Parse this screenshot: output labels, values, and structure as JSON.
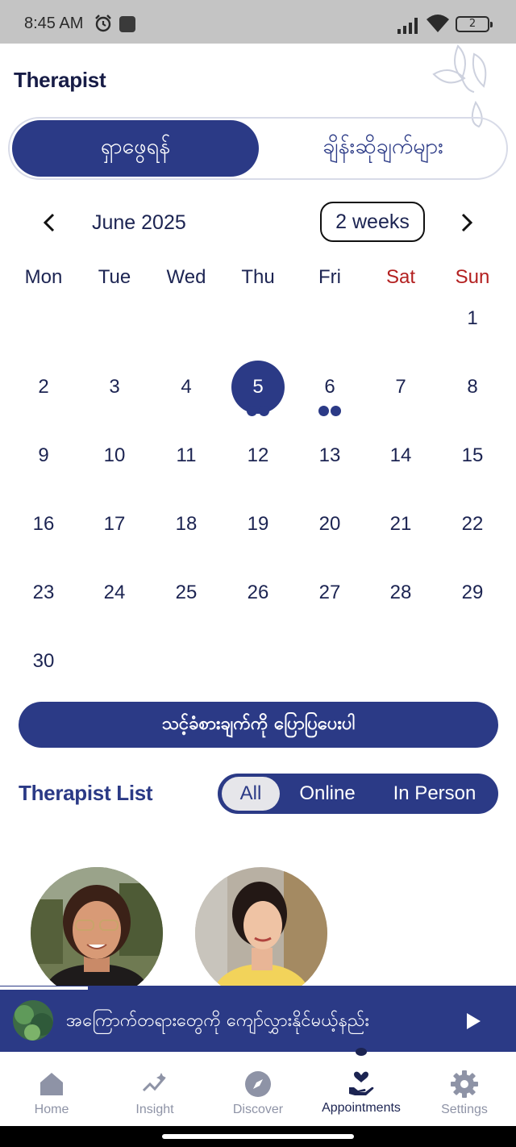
{
  "status_bar": {
    "time": "8:45 AM",
    "battery": "2",
    "icons": [
      "alarm-icon",
      "app-notification-icon",
      "signal-icon",
      "wifi-icon",
      "battery-icon"
    ]
  },
  "header": {
    "title": "Therapist"
  },
  "segment": {
    "active_label": "ရှာဖွေရန်",
    "inactive_label": "ချိန်းဆိုချက်များ"
  },
  "calendar": {
    "month_label": "June 2025",
    "range_label": "2 weeks",
    "weekdays": [
      "Mon",
      "Tue",
      "Wed",
      "Thu",
      "Fri",
      "Sat",
      "Sun"
    ],
    "selected_day": "5",
    "days_with_appointments": [
      "5",
      "6"
    ],
    "weeks": [
      [
        "",
        "",
        "",
        "",
        "",
        "",
        "1"
      ],
      [
        "2",
        "3",
        "4",
        "5",
        "6",
        "7",
        "8"
      ],
      [
        "9",
        "10",
        "11",
        "12",
        "13",
        "14",
        "15"
      ],
      [
        "16",
        "17",
        "18",
        "19",
        "20",
        "21",
        "22"
      ],
      [
        "23",
        "24",
        "25",
        "26",
        "27",
        "28",
        "29"
      ],
      [
        "30",
        "",
        "",
        "",
        "",
        "",
        ""
      ]
    ]
  },
  "cta": {
    "label": "သင့်ခံစားချက်ကို ပြောပြပေးပါ"
  },
  "therapist_list": {
    "title": "Therapist List",
    "filters": [
      "All",
      "Online",
      "In Person"
    ],
    "selected_filter": "All"
  },
  "player": {
    "title": "အကြောက်တရားတွေကို ကျော်လွှားနိုင်မယ့်နည်း",
    "progress": 0.17
  },
  "bottom_nav": {
    "items": [
      {
        "label": "Home",
        "icon": "home-icon"
      },
      {
        "label": "Insight",
        "icon": "insight-icon"
      },
      {
        "label": "Discover",
        "icon": "compass-icon"
      },
      {
        "label": "Appointments",
        "icon": "hand-heart-icon"
      },
      {
        "label": "Settings",
        "icon": "gear-icon"
      }
    ],
    "active": "Appointments"
  },
  "colors": {
    "primary": "#2b3a86",
    "weekend": "#b32020",
    "text": "#1c2452",
    "status_bar": "#c4c4c4"
  }
}
